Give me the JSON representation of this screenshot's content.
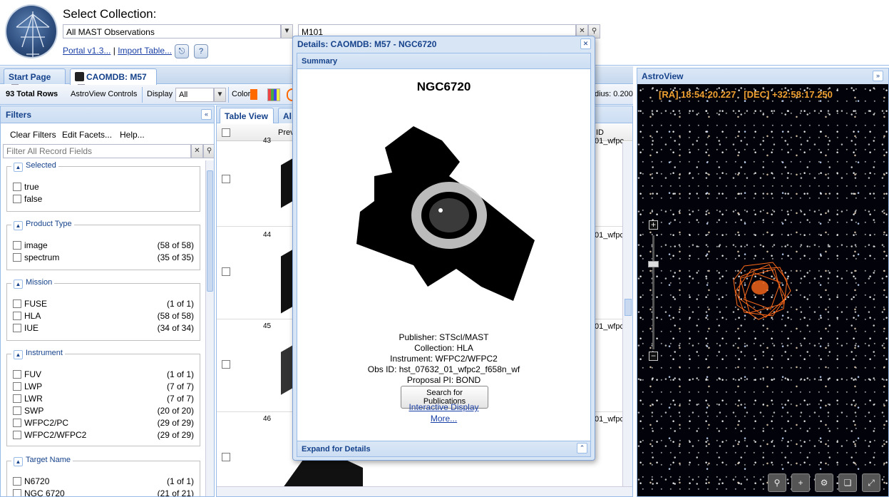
{
  "header": {
    "title": "Select Collection:",
    "collection_value": "All MAST Observations",
    "search_value": "M101",
    "portal_link": "Portal v1.3...",
    "separator": "|",
    "import_link": "Import Table..."
  },
  "tabs": [
    {
      "label": "Start Page"
    },
    {
      "label": "CAOMDB: M57"
    }
  ],
  "toolbar": {
    "total_rows": "93 Total Rows",
    "astroview_controls": "AstroView Controls",
    "display_label": "Display",
    "display_value": "All",
    "color_label": "Color",
    "color_value": "#ff6a00",
    "radius_text": "dius: 0.200"
  },
  "filters": {
    "title": "Filters",
    "clear": "Clear Filters",
    "edit": "Edit Facets...",
    "help": "Help...",
    "search_placeholder": "Filter All Record Fields",
    "groups": [
      {
        "title": "Selected",
        "options": [
          {
            "label": "true",
            "count": ""
          },
          {
            "label": "false",
            "count": ""
          }
        ]
      },
      {
        "title": "Product Type",
        "options": [
          {
            "label": "image",
            "count": "(58 of 58)"
          },
          {
            "label": "spectrum",
            "count": "(35 of 35)"
          }
        ]
      },
      {
        "title": "Mission",
        "options": [
          {
            "label": "FUSE",
            "count": "(1 of 1)"
          },
          {
            "label": "HLA",
            "count": "(58 of 58)"
          },
          {
            "label": "IUE",
            "count": "(34 of 34)"
          }
        ]
      },
      {
        "title": "Instrument",
        "options": [
          {
            "label": "FUV",
            "count": "(1 of 1)"
          },
          {
            "label": "LWP",
            "count": "(7 of 7)"
          },
          {
            "label": "LWR",
            "count": "(7 of 7)"
          },
          {
            "label": "SWP",
            "count": "(20 of 20)"
          },
          {
            "label": "WFPC2/PC",
            "count": "(29 of 29)"
          },
          {
            "label": "WFPC2/WFPC2",
            "count": "(29 of 29)"
          }
        ]
      },
      {
        "title": "Target Name",
        "options": [
          {
            "label": "N6720",
            "count": "(1 of 1)"
          },
          {
            "label": "NGC 6720",
            "count": "(21 of 21)"
          }
        ]
      }
    ]
  },
  "grid": {
    "tab_table": "Table View",
    "tab_other": "Al",
    "col_preview": "Prev",
    "col_id": "ID",
    "rows": [
      {
        "num": "43",
        "id": "01_wfpc"
      },
      {
        "num": "44",
        "id": "01_wfpc"
      },
      {
        "num": "45",
        "id": "01_wfpc"
      },
      {
        "num": "46",
        "id": "01_wfpc"
      }
    ]
  },
  "dialog": {
    "title": "Details: CAOMDB: M57 - NGC6720",
    "summary_header": "Summary",
    "object_name": "NGC6720",
    "publisher": "Publisher: STScI/MAST",
    "collection": "Collection: HLA",
    "instrument": "Instrument: WFPC2/WFPC2",
    "obs_id": "Obs ID: hst_07632_01_wfpc2_f658n_wf",
    "proposal_pi": "Proposal PI: BOND",
    "search_button": "Search for Publications",
    "interactive_link": "Interactive Display",
    "more_link": "More...",
    "expand": "Expand for Details"
  },
  "astroview": {
    "title": "AstroView",
    "ra": "[RA] 18:54:20.227",
    "dec": "[DEC] +32:58:17.250",
    "overlay_color": "#ff6a1a"
  }
}
